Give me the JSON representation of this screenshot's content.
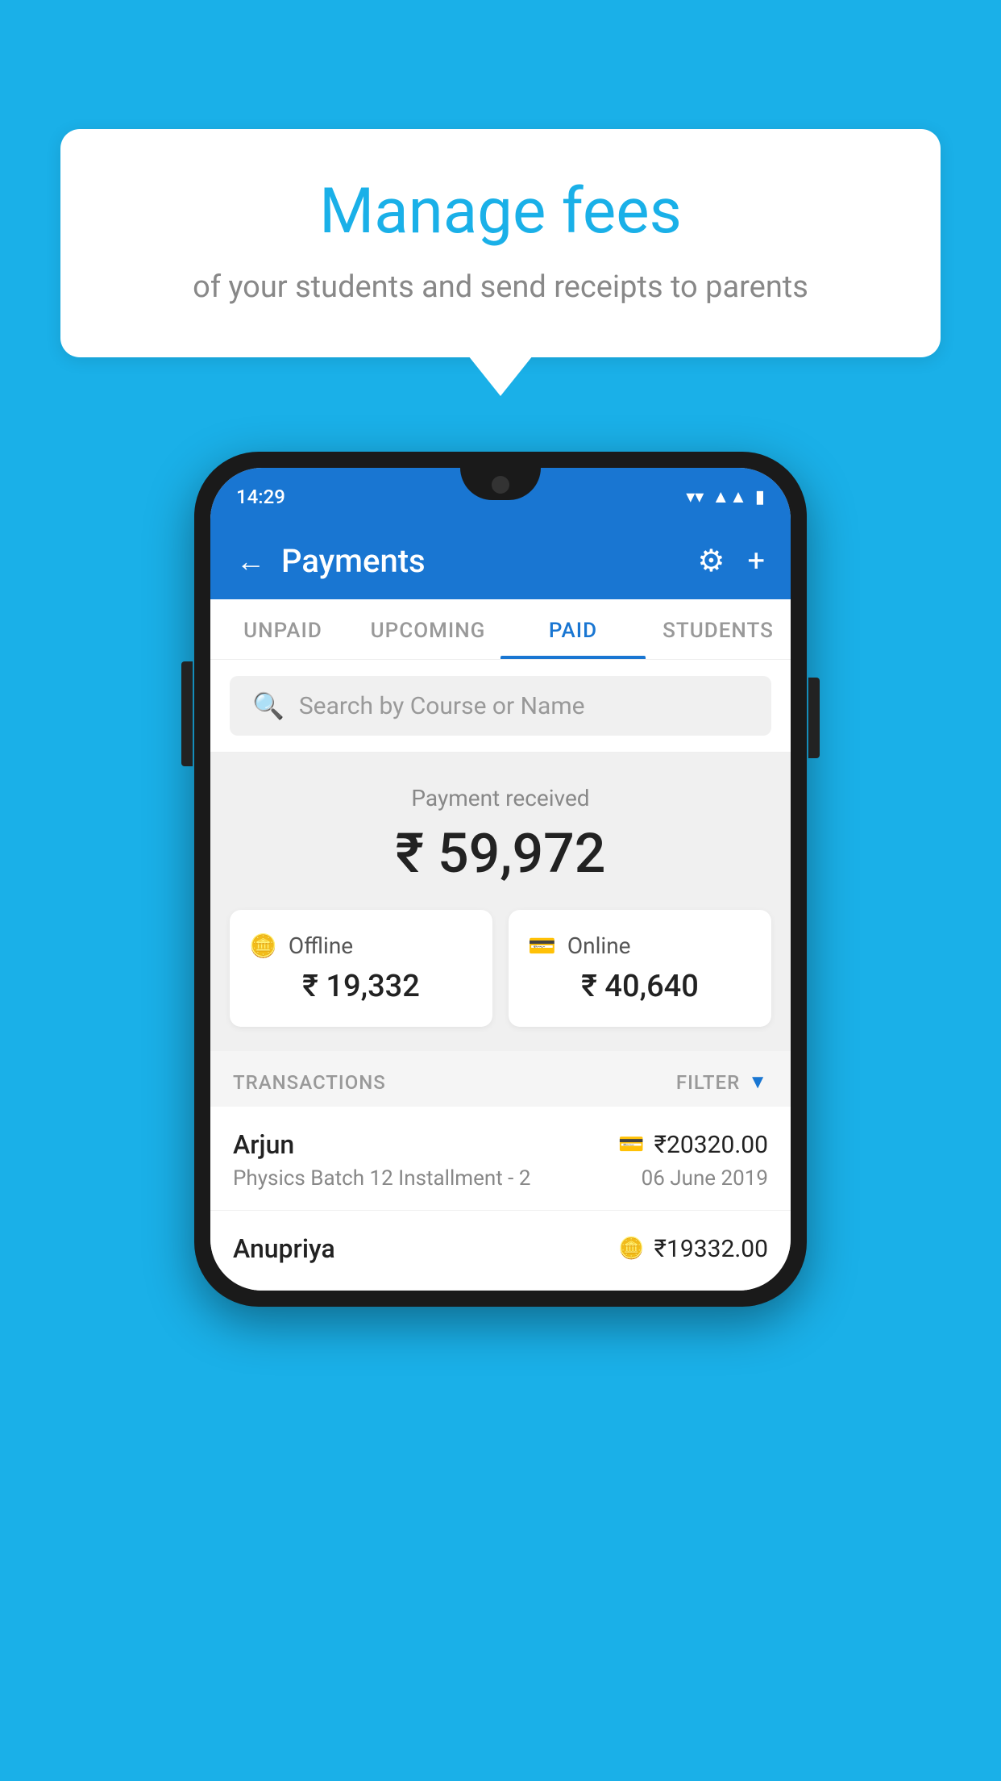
{
  "background_color": "#1ab0e8",
  "tooltip": {
    "title": "Manage fees",
    "subtitle": "of your students and send receipts to parents"
  },
  "phone": {
    "status_bar": {
      "time": "14:29"
    },
    "header": {
      "title": "Payments",
      "back_label": "←",
      "gear_label": "⚙",
      "plus_label": "+"
    },
    "tabs": [
      {
        "label": "UNPAID",
        "active": false
      },
      {
        "label": "UPCOMING",
        "active": false
      },
      {
        "label": "PAID",
        "active": true
      },
      {
        "label": "STUDENTS",
        "active": false
      }
    ],
    "search": {
      "placeholder": "Search by Course or Name"
    },
    "payment_summary": {
      "label": "Payment received",
      "total": "₹ 59,972",
      "offline": {
        "label": "Offline",
        "amount": "₹ 19,332"
      },
      "online": {
        "label": "Online",
        "amount": "₹ 40,640"
      }
    },
    "transactions": {
      "header_label": "TRANSACTIONS",
      "filter_label": "FILTER",
      "items": [
        {
          "name": "Arjun",
          "course": "Physics Batch 12 Installment - 2",
          "amount": "₹20320.00",
          "date": "06 June 2019",
          "payment_type": "online"
        },
        {
          "name": "Anupriya",
          "course": "",
          "amount": "₹19332.00",
          "date": "",
          "payment_type": "offline"
        }
      ]
    }
  }
}
